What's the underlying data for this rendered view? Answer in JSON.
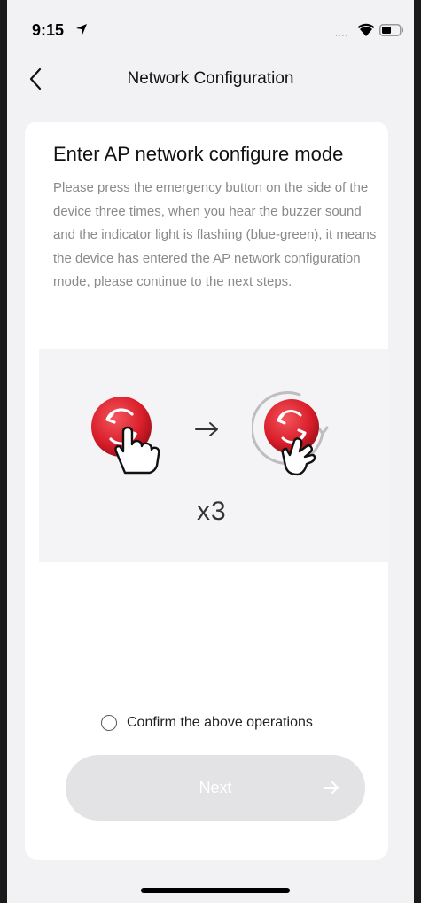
{
  "status_bar": {
    "time": "9:15",
    "signal_dots": "....",
    "icons": [
      "location-arrow-icon",
      "wifi-icon",
      "battery-icon"
    ]
  },
  "nav": {
    "title": "Network Configuration",
    "back_icon": "chevron-left-icon"
  },
  "card": {
    "title": "Enter AP network configure mode",
    "description": "Please press the emergency button on the side of the device three times, when you hear the buzzer sound and the indicator light is flashing (blue-green), it means the device has entered the AP network configuration mode, please continue to the next steps.",
    "illustration": {
      "multiplier": "x3",
      "icons": [
        "emergency-button-icon",
        "tapping-hand-icon",
        "arrow-right-icon",
        "rotating-ring-icon"
      ],
      "button_color": "#d81e2a"
    },
    "confirm_label": "Confirm the above operations",
    "next_button": {
      "label": "Next",
      "icon": "arrow-right-icon",
      "disabled": true
    }
  }
}
